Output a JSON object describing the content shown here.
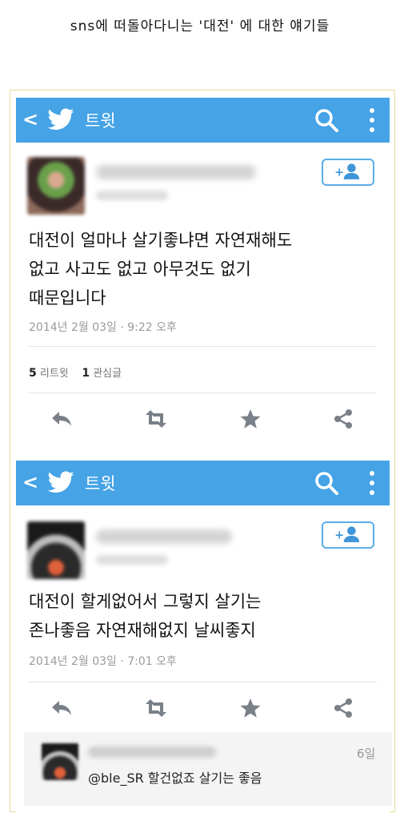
{
  "page_title": "sns에 떠돌아다니는 '대전' 에 대한 얘기들",
  "tweets": [
    {
      "header_title": "트윗",
      "text_lines": [
        "대전이 얼마나 살기좋냐면 자연재해도",
        "없고 사고도 없고 아무것도 없기",
        "때문입니다"
      ],
      "timestamp": "2014년 2월 03일 · 9:22 오후",
      "retweets_count": "5",
      "retweets_label": "리트윗",
      "favorites_count": "1",
      "favorites_label": "관심글"
    },
    {
      "header_title": "트윗",
      "text_lines": [
        "대전이 할게없어서 그렇지 살기는",
        "존나좋음 자연재해없지 날씨좋지"
      ],
      "timestamp": "2014년 2월 03일 · 7:01 오후"
    }
  ],
  "reply": {
    "age": "6일",
    "text": "@ble_SR 할건없죠 살기는 좋음"
  },
  "colors": {
    "topbar": "#45a3e6",
    "follow_border": "#5aaee6",
    "icon": "#7a8088"
  }
}
